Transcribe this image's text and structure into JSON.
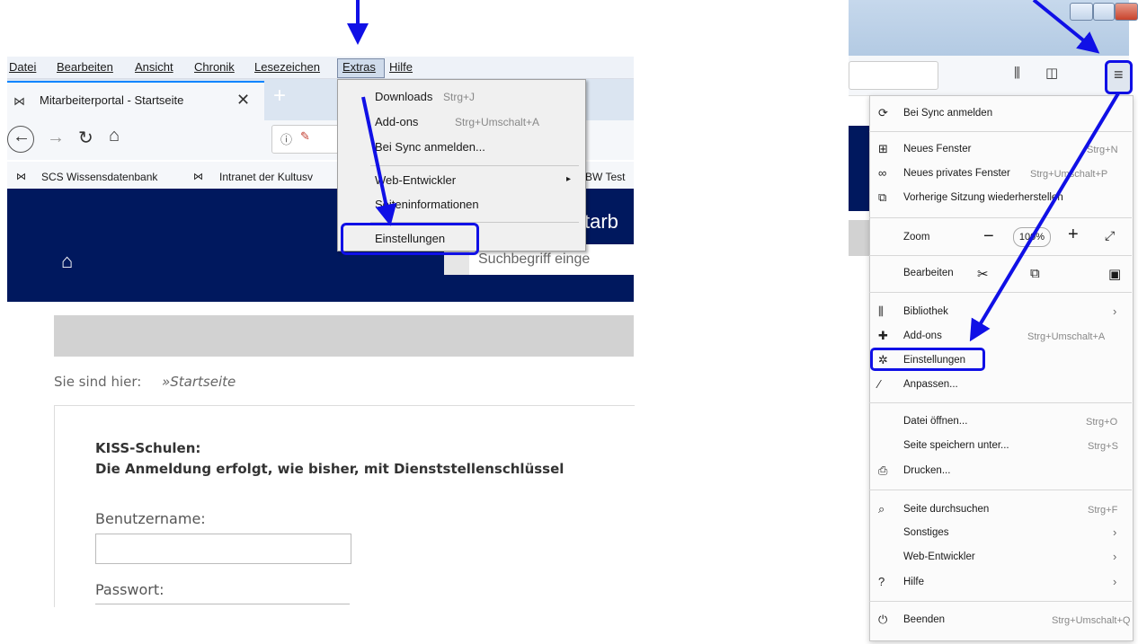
{
  "menubar": {
    "items": [
      "Datei",
      "Bearbeiten",
      "Ansicht",
      "Chronik",
      "Lesezeichen",
      "Extras",
      "Hilfe"
    ]
  },
  "tab": {
    "title": "Mitarbeiterportal - Startseite",
    "close": "✕",
    "new_tab": "+"
  },
  "bookmarks": [
    "SCS Wissensdatenbank",
    "Intranet der Kultusv",
    "BW Test"
  ],
  "extras_menu": {
    "items": [
      {
        "label": "Downloads",
        "accel": "Strg+J"
      },
      {
        "label": "Add-ons",
        "accel": "Strg+Umschalt+A"
      },
      {
        "label": "Bei Sync anmelden...",
        "accel": ""
      },
      {
        "label": "Web-Entwickler",
        "accel": ""
      },
      {
        "label": "Seiteninformationen",
        "accel": ""
      },
      {
        "label": "Einstellungen",
        "accel": ""
      }
    ]
  },
  "page": {
    "banner_title": "tarb",
    "search_placeholder": "Suchbegriff einge",
    "breadcrumb_label": "Sie sind hier:",
    "breadcrumb_link": "»Startseite",
    "notice_title": "KISS-Schulen:",
    "notice_text": "Die Anmeldung erfolgt, wie bisher, mit Dienststellenschlüssel",
    "username_label": "Benutzername:",
    "password_label": "Passwort:"
  },
  "app_menu": {
    "sync": "Bei Sync anmelden",
    "new_window": "Neues Fenster",
    "new_window_accel": "Strg+N",
    "private_window": "Neues privates Fenster",
    "private_window_accel": "Strg+Umschalt+P",
    "restore": "Vorherige Sitzung wiederherstellen",
    "zoom_label": "Zoom",
    "zoom_value": "100%",
    "edit_label": "Bearbeiten",
    "library": "Bibliothek",
    "addons": "Add-ons",
    "addons_accel": "Strg+Umschalt+A",
    "settings": "Einstellungen",
    "customize": "Anpassen...",
    "open_file": "Datei öffnen...",
    "open_file_accel": "Strg+O",
    "save_page": "Seite speichern unter...",
    "save_page_accel": "Strg+S",
    "print": "Drucken...",
    "find": "Seite durchsuchen",
    "find_accel": "Strg+F",
    "more": "Sonstiges",
    "webdev": "Web-Entwickler",
    "help": "Hilfe",
    "quit": "Beenden",
    "quit_accel": "Strg+Umschalt+Q"
  },
  "colors": {
    "annotation_blue": "#1010e6",
    "banner_navy": "#00185e",
    "tab_accent": "#0a84ff"
  }
}
